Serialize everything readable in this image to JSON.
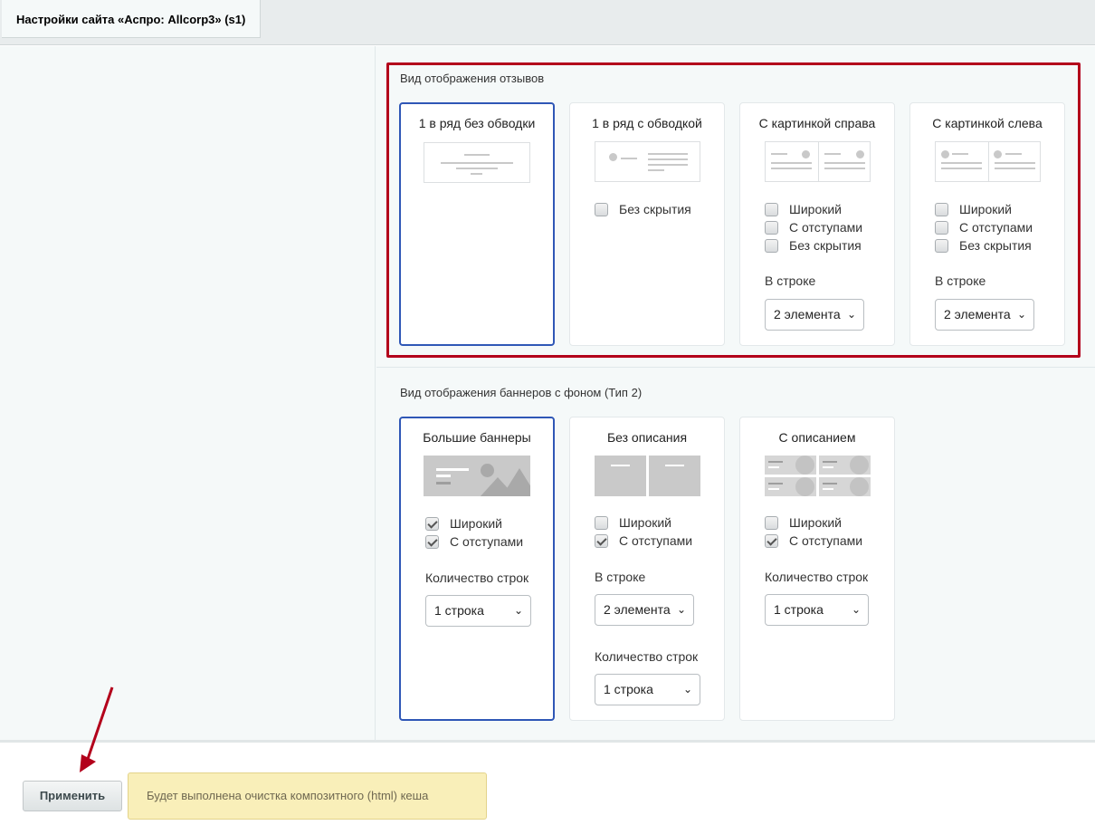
{
  "tab": {
    "label": "Настройки сайта «Аспро: Allcorp3» (s1)"
  },
  "reviews": {
    "title": "Вид отображения отзывов",
    "cards": [
      {
        "title": "1 в ряд без обводки"
      },
      {
        "title": "1 в ряд с обводкой",
        "checkboxes": [
          {
            "label": "Без скрытия",
            "checked": false
          }
        ]
      },
      {
        "title": "С картинкой справа",
        "checkboxes": [
          {
            "label": "Широкий",
            "checked": false
          },
          {
            "label": "С отступами",
            "checked": false
          },
          {
            "label": "Без скрытия",
            "checked": false
          }
        ],
        "row_label": "В строке",
        "row_select": "2 элемента"
      },
      {
        "title": "С картинкой слева",
        "checkboxes": [
          {
            "label": "Широкий",
            "checked": false
          },
          {
            "label": "С отступами",
            "checked": false
          },
          {
            "label": "Без скрытия",
            "checked": false
          }
        ],
        "row_label": "В строке",
        "row_select": "2 элемента"
      }
    ]
  },
  "banners": {
    "title": "Вид отображения баннеров с фоном (Тип 2)",
    "cards": [
      {
        "title": "Большие баннеры",
        "checkboxes": [
          {
            "label": "Широкий",
            "checked": true
          },
          {
            "label": "С отступами",
            "checked": true
          }
        ],
        "rows_label": "Количество строк",
        "rows_select": "1 строка"
      },
      {
        "title": "Без описания",
        "checkboxes": [
          {
            "label": "Широкий",
            "checked": false
          },
          {
            "label": "С отступами",
            "checked": true
          }
        ],
        "row_label": "В строке",
        "row_select": "2 элемента",
        "rows_label": "Количество строк",
        "rows_select": "1 строка"
      },
      {
        "title": "С описанием",
        "checkboxes": [
          {
            "label": "Широкий",
            "checked": false
          },
          {
            "label": "С отступами",
            "checked": true
          }
        ],
        "rows_label": "Количество строк",
        "rows_select": "1 строка"
      }
    ]
  },
  "footer": {
    "apply_label": "Применить",
    "notice": "Будет выполнена очистка композитного (html) кеша"
  },
  "colors": {
    "highlight": "#b3001b",
    "active_border": "#2f57b6",
    "notice_bg": "#f9efb9",
    "arrow": "#b3001b"
  }
}
